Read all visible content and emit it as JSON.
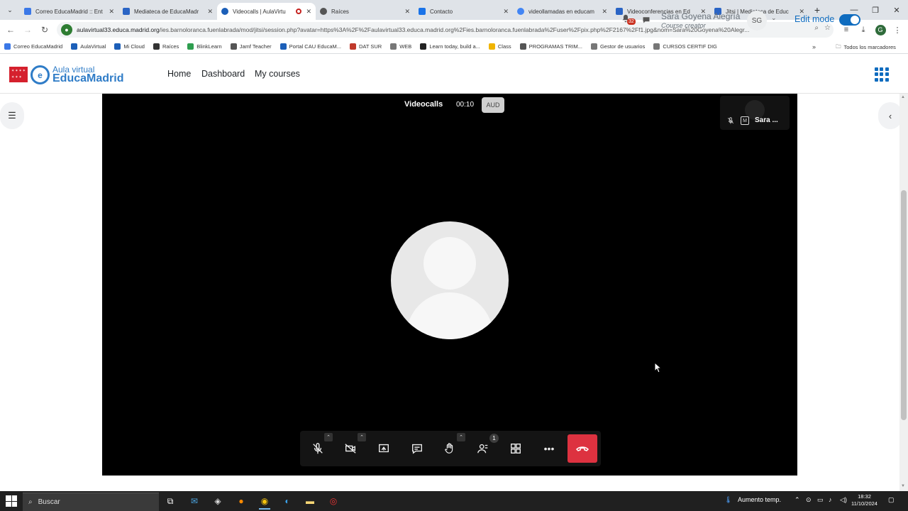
{
  "browser": {
    "tabs": [
      {
        "title": "Correo EducaMadrid :: Ent",
        "color": "#3b78e7"
      },
      {
        "title": "Mediateca de EducaMadr",
        "color": "#2a64c5"
      },
      {
        "title": "Videocalls | AulaVirtu",
        "color": "#1c5fb8"
      },
      {
        "title": "Raíces",
        "color": "#555555"
      },
      {
        "title": "Contacto",
        "color": "#1a73e8"
      },
      {
        "title": "videollamadas en educam",
        "color": "#4285f4"
      },
      {
        "title": "Videoconferencias en Ed",
        "color": "#2a64c5"
      },
      {
        "title": "Jitsi | Mediateca de Educ",
        "color": "#2a64c5"
      }
    ],
    "url_host": "aulavirtual33.educa.madrid.org",
    "url_rest": "/ies.barnoloranca.fuenlabrada/mod/jitsi/session.php?avatar=https%3A%2F%2Faulavirtual33.educa.madrid.org%2Fies.barnoloranca.fuenlabrada%2Fuser%2Fpix.php%2F2167%2Ff1.jpg&nom=Sara%20Goyena%20Alegr...",
    "bookmarks": [
      {
        "label": "Correo EducaMadrid",
        "color": "#3b78e7"
      },
      {
        "label": "AulaVirtual",
        "color": "#1c5fb8"
      },
      {
        "label": "Mi Cloud",
        "color": "#1c5fb8"
      },
      {
        "label": "Raíces",
        "color": "#333333"
      },
      {
        "label": "BlinkLearn",
        "color": "#2e9e4f"
      },
      {
        "label": "Jamf Teacher",
        "color": "#555555"
      },
      {
        "label": "Portal CAU EducaM...",
        "color": "#1c5fb8"
      },
      {
        "label": "DAT SUR",
        "color": "#c0392b"
      },
      {
        "label": "WEB",
        "color": "#777777"
      },
      {
        "label": "Learn today, build a...",
        "color": "#222222"
      },
      {
        "label": "Class",
        "color": "#f0b400"
      },
      {
        "label": "PROGRAMAS TRIM...",
        "color": "#555555"
      },
      {
        "label": "Gestor de usuarios",
        "color": "#777777"
      },
      {
        "label": "CURSOS CERTIF DIG",
        "color": "#777777"
      }
    ],
    "all_bookmarks": "Todos los marcadores"
  },
  "header": {
    "logo_line1": "Aula virtual",
    "logo_line2": "EducaMadrid",
    "nav": [
      "Home",
      "Dashboard",
      "My courses"
    ],
    "notifications_count": "32",
    "user_name": "Sara Goyena Alegría",
    "user_role": "Course creator",
    "user_initials": "SG",
    "edit_mode_label": "Edit mode"
  },
  "meeting": {
    "title": "Videocalls",
    "timer": "00:10",
    "badge": "AUD",
    "participant_name": "Sara ...",
    "participant_moderator_badge": "M",
    "participants_count": "1"
  },
  "taskbar": {
    "search_placeholder": "Buscar",
    "weather": "Aumento temp.",
    "time": "18:32",
    "date": "11/10/2024"
  }
}
